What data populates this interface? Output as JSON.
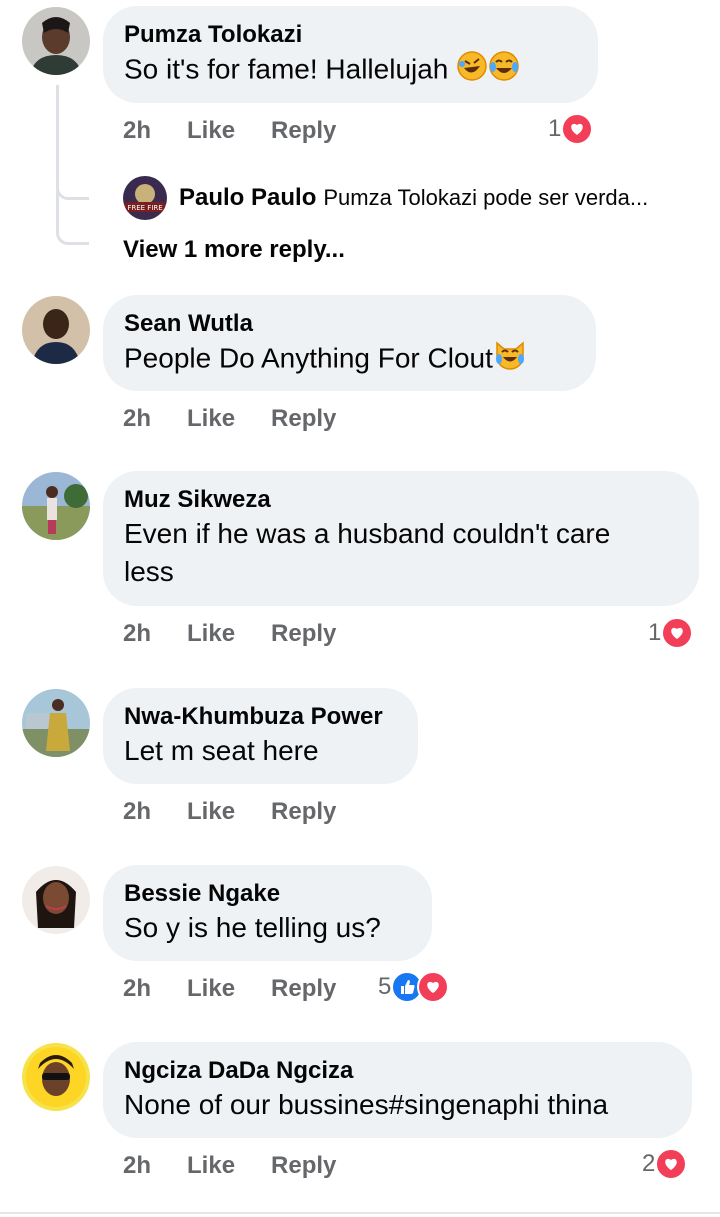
{
  "comments": [
    {
      "author": "Pumza Tolokazi",
      "text": "So it's for fame! Hallelujah",
      "time": "2h",
      "like": "Like",
      "reply": "Reply",
      "reactions": "1"
    },
    {
      "author": "Sean Wutla",
      "text": "People Do Anything For Clout",
      "time": "2h",
      "like": "Like",
      "reply": "Reply"
    },
    {
      "author": "Muz Sikweza",
      "text_line1": "Even if he was a husband couldn't care",
      "text_line2": "less",
      "time": "2h",
      "like": "Like",
      "reply": "Reply",
      "reactions": "1"
    },
    {
      "author": "Nwa-Khumbuza Power",
      "text": "Let m seat here",
      "time": "2h",
      "like": "Like",
      "reply": "Reply"
    },
    {
      "author": "Bessie Ngake",
      "text": "So y is he telling us?",
      "time": "2h",
      "like": "Like",
      "reply": "Reply",
      "reactions": "5"
    },
    {
      "author": "Ngciza DaDa Ngciza",
      "text": "None of our bussines#singenaphi thina",
      "time": "2h",
      "like": "Like",
      "reply": "Reply",
      "reactions": "2"
    }
  ],
  "nested_reply": {
    "author": "Paulo Paulo",
    "text": "Pumza Tolokazi pode ser verda...",
    "avatar_label": "FREE FIRE"
  },
  "view_more": "View 1 more reply...",
  "colors": {
    "bubble": "#eff2f5",
    "meta": "#65676b",
    "heart": "#f33e58",
    "like_blue": "#1877f2"
  }
}
